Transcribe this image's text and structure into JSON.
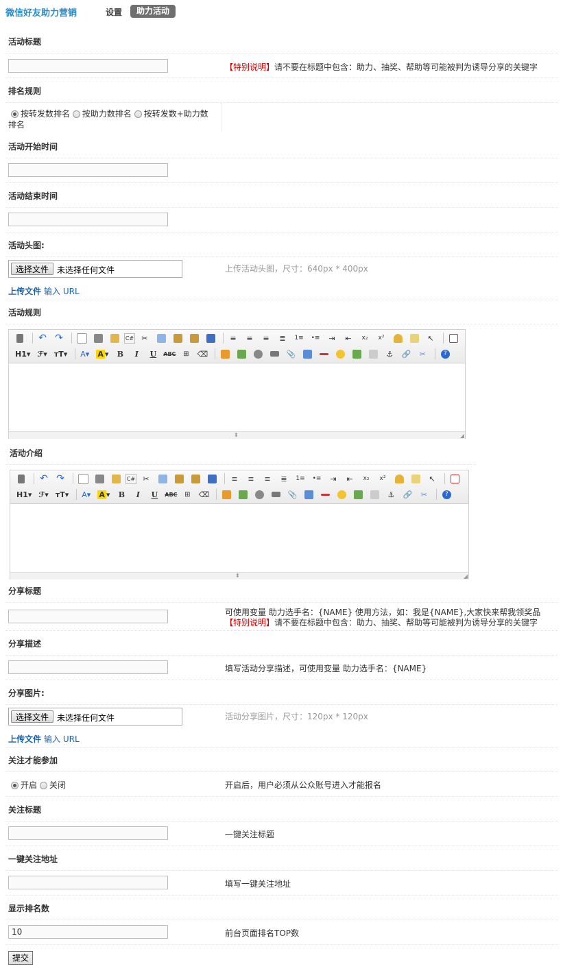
{
  "header": {
    "brand": "微信好友助力营销",
    "tab_settings": "设置",
    "tab_active": "助力活动"
  },
  "fields": {
    "activity_title": {
      "label": "活动标题",
      "value": "",
      "warn_prefix": "【特别说明】",
      "hint": "请不要在标题中包含：助力、抽奖、帮助等可能被判为诱导分享的关键字"
    },
    "ranking_rule": {
      "label": "排名规则",
      "options": [
        "按转发数排名",
        "按助力数排名",
        "按转发数+助力数排名"
      ],
      "option3_line1": "按转发数+助力数",
      "option3_line2": "排名",
      "selected": "按转发数排名"
    },
    "start_time": {
      "label": "活动开始时间",
      "value": ""
    },
    "end_time": {
      "label": "活动结束时间",
      "value": ""
    },
    "head_image": {
      "label": "活动头图:",
      "file_button": "选择文件",
      "file_status": "未选择任何文件",
      "upload_link": "上传文件",
      "url_link": "输入 URL",
      "hint": "上传活动头图，尺寸：640px * 400px"
    },
    "rules": {
      "label": "活动规则"
    },
    "intro": {
      "label": "活动介绍"
    },
    "share_title": {
      "label": "分享标题",
      "value": "",
      "hint_line1": "可使用变量 助力选手名：{NAME} 使用方法，如：我是{NAME},大家快来帮我领奖品",
      "warn_prefix": "【特别说明】",
      "hint_line2": "请不要在标题中包含：助力、抽奖、帮助等可能被判为诱导分享的关键字"
    },
    "share_desc": {
      "label": "分享描述",
      "value": "",
      "hint": "填写活动分享描述，可使用变量 助力选手名：{NAME}"
    },
    "share_image": {
      "label": "分享图片:",
      "file_button": "选择文件",
      "file_status": "未选择任何文件",
      "upload_link": "上传文件",
      "url_link": "输入 URL",
      "hint": "活动分享图片，尺寸：120px * 120px"
    },
    "follow_required": {
      "label": "关注才能参加",
      "options": [
        "开启",
        "关闭"
      ],
      "selected": "开启",
      "hint": "开启后，用户必须从公众账号进入才能报名"
    },
    "follow_title": {
      "label": "关注标题",
      "value": "",
      "hint": "一键关注标题"
    },
    "follow_url": {
      "label": "一键关注地址",
      "value": "",
      "hint": "填写一键关注地址"
    },
    "rank_count": {
      "label": "显示排名数",
      "value": "10",
      "hint": "前台页面排名TOP数"
    }
  },
  "editor": {
    "heading": "H1",
    "font": "ℱ",
    "size": "тT",
    "font_color": "A",
    "highlight": "A",
    "bold": "B",
    "italic": "I",
    "underline": "U",
    "strike": "ABC"
  },
  "submit_label": "提交",
  "colors": {
    "brand": "#2a8bcc",
    "warn": "#d10000",
    "link": "#1a5fa8",
    "tab_active_bg": "#6f6f6f"
  }
}
